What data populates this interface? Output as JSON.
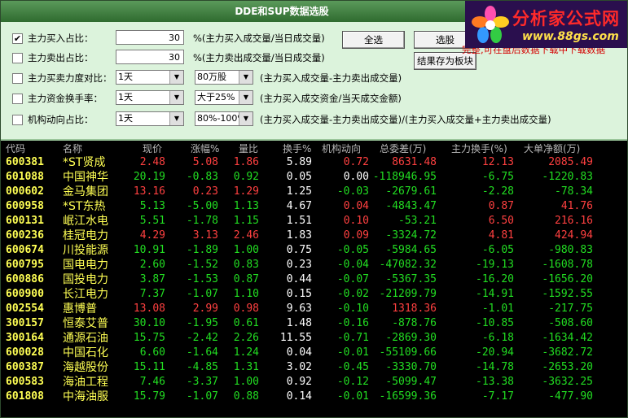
{
  "window": {
    "title": "DDE和SUP数据选股"
  },
  "logo": {
    "brand": "分析家公式网",
    "url": "www.88gs.com"
  },
  "panel": {
    "rows": [
      {
        "checked": "✔",
        "label": "主力买入占比：",
        "value": "30",
        "desc": "%(主力买入成交量/当日成交量)"
      },
      {
        "checked": "",
        "label": "主力卖出占比：",
        "value": "30",
        "desc": "%(主力卖出成交量/当日成交量)"
      },
      {
        "checked": "",
        "label": "主力买卖力度对比：",
        "sel1": "1天",
        "sel2": "80万股",
        "desc": "(主力买入成交量-主力卖出成交量)"
      },
      {
        "checked": "",
        "label": "主力资金换手率：",
        "sel1": "1天",
        "sel2": "大于25%",
        "desc": "(主力买入成交资金/当天成交金额)"
      },
      {
        "checked": "",
        "label": "机构动向占比：",
        "sel1": "1天",
        "sel2": "80%-100%",
        "desc": "(主力买入成交量-主力卖出成交量)/(主力买入成交量+主力卖出成交量)"
      }
    ],
    "buttons": {
      "select_all": "全选",
      "pick": "选股",
      "save_to_block": "结果存为板块"
    },
    "note": "完整,可在盘后数据下载中下载数据"
  },
  "table": {
    "headers": [
      "代码",
      "名称",
      "现价",
      "涨幅%",
      "量比",
      "换手%",
      "机构动向",
      "总委差(万)",
      "主力换手(%)",
      "大单净额(万)"
    ],
    "rows": [
      [
        "600381",
        "*ST贤成",
        "2.48",
        "5.08",
        "1.86",
        "5.89",
        "0.72",
        "8631.48",
        "12.13",
        "2085.49"
      ],
      [
        "601088",
        "中国神华",
        "20.19",
        "-0.83",
        "0.92",
        "0.05",
        "0.00",
        "-118946.95",
        "-6.75",
        "-1220.83"
      ],
      [
        "000602",
        "金马集团",
        "13.16",
        "0.23",
        "1.29",
        "1.25",
        "-0.03",
        "-2679.61",
        "-2.28",
        "-78.34"
      ],
      [
        "600958",
        "*ST东热",
        "5.13",
        "-5.00",
        "1.13",
        "4.67",
        "0.04",
        "-4843.47",
        "0.87",
        "41.76"
      ],
      [
        "600131",
        "岷江水电",
        "5.51",
        "-1.78",
        "1.15",
        "1.51",
        "0.10",
        "-53.21",
        "6.50",
        "216.16"
      ],
      [
        "600236",
        "桂冠电力",
        "4.29",
        "3.13",
        "2.46",
        "1.83",
        "0.09",
        "-3324.72",
        "4.81",
        "424.94"
      ],
      [
        "600674",
        "川投能源",
        "10.91",
        "-1.89",
        "1.00",
        "0.75",
        "-0.05",
        "-5984.65",
        "-6.05",
        "-980.83"
      ],
      [
        "600795",
        "国电电力",
        "2.60",
        "-1.52",
        "0.83",
        "0.23",
        "-0.04",
        "-47082.32",
        "-19.13",
        "-1608.78"
      ],
      [
        "600886",
        "国投电力",
        "3.87",
        "-1.53",
        "0.87",
        "0.44",
        "-0.07",
        "-5367.35",
        "-16.20",
        "-1656.20"
      ],
      [
        "600900",
        "长江电力",
        "7.37",
        "-1.07",
        "1.10",
        "0.15",
        "-0.02",
        "-21209.79",
        "-14.91",
        "-1592.55"
      ],
      [
        "002554",
        "惠博普",
        "13.08",
        "2.99",
        "0.98",
        "9.63",
        "-0.10",
        "1318.36",
        "-1.01",
        "-217.75"
      ],
      [
        "300157",
        "恒泰艾普",
        "30.10",
        "-1.95",
        "0.61",
        "1.48",
        "-0.16",
        "-878.76",
        "-10.85",
        "-508.60"
      ],
      [
        "300164",
        "通源石油",
        "15.75",
        "-2.42",
        "2.26",
        "11.55",
        "-0.71",
        "-2869.30",
        "-6.18",
        "-1634.42"
      ],
      [
        "600028",
        "中国石化",
        "6.60",
        "-1.64",
        "1.24",
        "0.04",
        "-0.01",
        "-55109.66",
        "-20.94",
        "-3682.72"
      ],
      [
        "600387",
        "海越股份",
        "15.11",
        "-4.85",
        "1.31",
        "3.02",
        "-0.45",
        "-3330.70",
        "-14.78",
        "-2653.20"
      ],
      [
        "600583",
        "海油工程",
        "7.46",
        "-3.37",
        "1.00",
        "0.92",
        "-0.12",
        "-5099.47",
        "-13.38",
        "-3632.25"
      ],
      [
        "601808",
        "中海油服",
        "15.79",
        "-1.07",
        "0.88",
        "0.14",
        "-0.01",
        "-16599.36",
        "-7.17",
        "-477.90"
      ]
    ]
  },
  "colors": {
    "up": "#ff4040",
    "down": "#22dd22",
    "flat": "#ffffff",
    "code": "#ffff54"
  }
}
